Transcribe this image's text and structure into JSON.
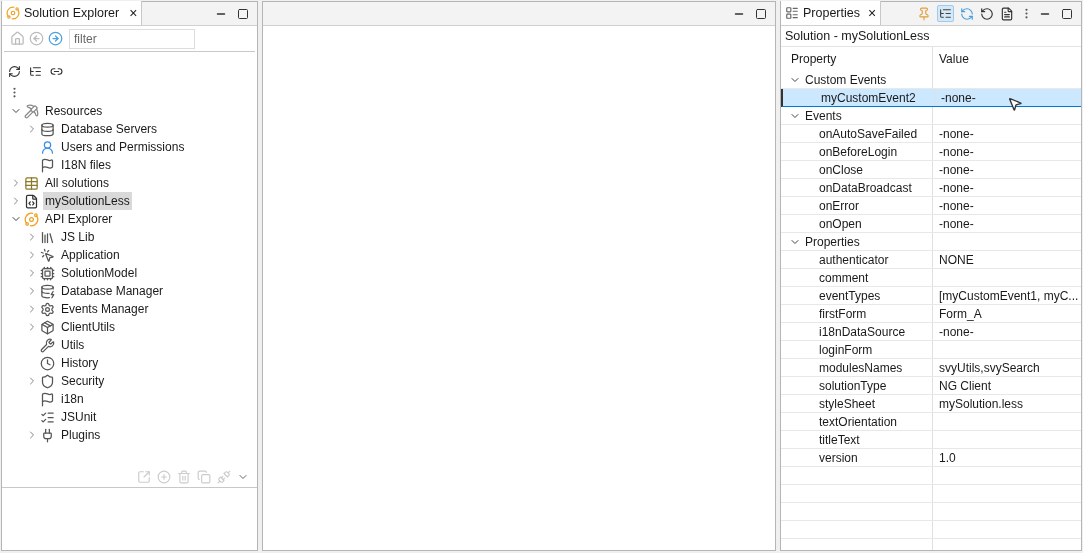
{
  "explorer": {
    "tab": {
      "label": "Solution Explorer",
      "close": "×"
    },
    "filter": {
      "placeholder": "filter"
    },
    "tree": [
      {
        "label": "Resources",
        "expanded": true,
        "selected": false,
        "children": [
          {
            "label": "Database Servers",
            "expanded": false,
            "selected": false
          },
          {
            "label": "Users and Permissions",
            "selected": false
          },
          {
            "label": "I18N files",
            "selected": false
          }
        ]
      },
      {
        "label": "All solutions",
        "expanded": false,
        "selected": false
      },
      {
        "label": "mySolutionLess",
        "expanded": false,
        "selected": true
      },
      {
        "label": "API Explorer",
        "expanded": true,
        "selected": false,
        "children": [
          {
            "label": "JS Lib",
            "expanded": false,
            "selected": false
          },
          {
            "label": "Application",
            "expanded": false,
            "selected": false
          },
          {
            "label": "SolutionModel",
            "expanded": false,
            "selected": false
          },
          {
            "label": "Database Manager",
            "expanded": false,
            "selected": false
          },
          {
            "label": "Events Manager",
            "expanded": false,
            "selected": false
          },
          {
            "label": "ClientUtils",
            "expanded": false,
            "selected": false
          },
          {
            "label": "Utils",
            "selected": false
          },
          {
            "label": "History",
            "selected": false
          },
          {
            "label": "Security",
            "expanded": false,
            "selected": false
          },
          {
            "label": "i18n",
            "selected": false
          },
          {
            "label": "JSUnit",
            "selected": false
          },
          {
            "label": "Plugins",
            "expanded": false,
            "selected": false
          }
        ]
      }
    ]
  },
  "properties": {
    "tab": {
      "label": "Properties",
      "close": "×"
    },
    "subject": "Solution - mySolutionLess",
    "columns": [
      "Property",
      "Value"
    ],
    "groups": [
      {
        "label": "Custom Events",
        "expanded": true,
        "rows": [
          {
            "name": "myCustomEvent2",
            "value": "-none-",
            "selected": true
          }
        ]
      },
      {
        "label": "Events",
        "expanded": true,
        "rows": [
          {
            "name": "onAutoSaveFailed",
            "value": "-none-",
            "selected": false
          },
          {
            "name": "onBeforeLogin",
            "value": "-none-",
            "selected": false
          },
          {
            "name": "onClose",
            "value": "-none-",
            "selected": false
          },
          {
            "name": "onDataBroadcast",
            "value": "-none-",
            "selected": false
          },
          {
            "name": "onError",
            "value": "-none-",
            "selected": false
          },
          {
            "name": "onOpen",
            "value": "-none-",
            "selected": false
          }
        ]
      },
      {
        "label": "Properties",
        "expanded": true,
        "rows": [
          {
            "name": "authenticator",
            "value": "NONE",
            "selected": false
          },
          {
            "name": "comment",
            "selected": false
          },
          {
            "name": "eventTypes",
            "value": "[myCustomEvent1, myC...",
            "selected": false
          },
          {
            "name": "firstForm",
            "value": "Form_A",
            "selected": false
          },
          {
            "name": "i18nDataSource",
            "value": "-none-",
            "selected": false
          },
          {
            "name": "loginForm",
            "selected": false
          },
          {
            "name": "modulesNames",
            "value": "svyUtils,svySearch",
            "selected": false
          },
          {
            "name": "solutionType",
            "value": "NG Client",
            "selected": false
          },
          {
            "name": "styleSheet",
            "value": "mySolution.less",
            "selected": false
          },
          {
            "name": "textOrientation",
            "selected": false
          },
          {
            "name": "titleText",
            "selected": false
          },
          {
            "name": "version",
            "value": "1.0",
            "selected": false
          }
        ]
      }
    ]
  }
}
